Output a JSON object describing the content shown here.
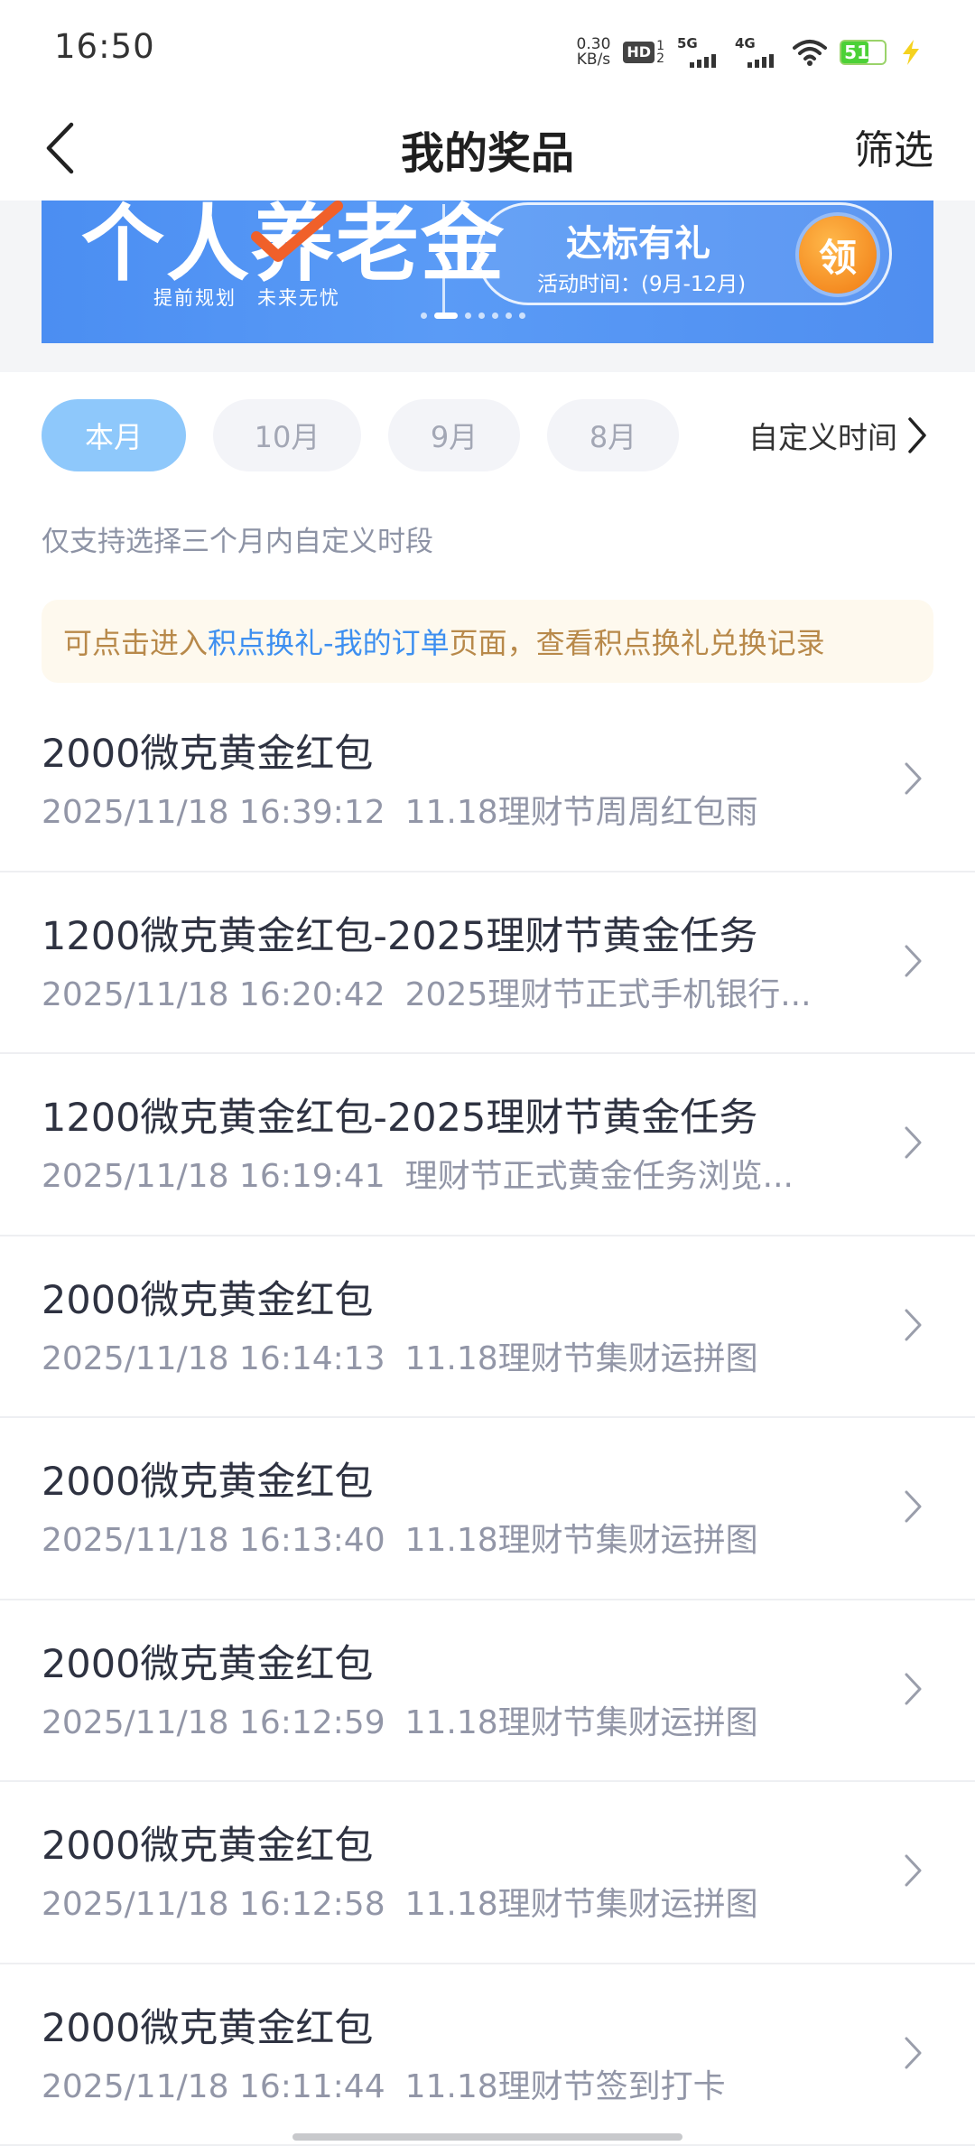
{
  "status_bar": {
    "time": "16:50",
    "net_speed_value": "0.30",
    "net_speed_unit": "KB/s",
    "hd_label": "HD",
    "hd_sub_top": "1",
    "hd_sub_bottom": "2",
    "sig1_label": "5G",
    "sig2_label": "4G",
    "battery_level": "51"
  },
  "header": {
    "title": "我的奖品",
    "filter_label": "筛选"
  },
  "banner": {
    "big_text": "个人养老金",
    "sub_text": "提前规划　未来无忧",
    "pill_title": "达标有礼",
    "pill_date": "活动时间：(9月-12月)",
    "pill_button": "领"
  },
  "tabs": {
    "items": [
      "本月",
      "10月",
      "9月",
      "8月"
    ],
    "active_index": 0,
    "custom_label": "自定义时间"
  },
  "hint": "仅支持选择三个月内自定义时段",
  "notice": {
    "prefix": "可点击进入",
    "link": "积点换礼-我的订单",
    "suffix": "页面，查看积点换礼兑换记录"
  },
  "prizes": [
    {
      "title": "2000微克黄金红包",
      "time": "2025/11/18 16:39:12",
      "source": "11.18理财节周周红包雨"
    },
    {
      "title": "1200微克黄金红包-2025理财节黄金任务",
      "time": "2025/11/18 16:20:42",
      "source": "2025理财节正式手机银行..."
    },
    {
      "title": "1200微克黄金红包-2025理财节黄金任务",
      "time": "2025/11/18 16:19:41",
      "source": "理财节正式黄金任务浏览..."
    },
    {
      "title": "2000微克黄金红包",
      "time": "2025/11/18 16:14:13",
      "source": "11.18理财节集财运拼图"
    },
    {
      "title": "2000微克黄金红包",
      "time": "2025/11/18 16:13:40",
      "source": "11.18理财节集财运拼图"
    },
    {
      "title": "2000微克黄金红包",
      "time": "2025/11/18 16:12:59",
      "source": "11.18理财节集财运拼图"
    },
    {
      "title": "2000微克黄金红包",
      "time": "2025/11/18 16:12:58",
      "source": "11.18理财节集财运拼图"
    },
    {
      "title": "2000微克黄金红包",
      "time": "2025/11/18 16:11:44",
      "source": "11.18理财节签到打卡"
    }
  ]
}
